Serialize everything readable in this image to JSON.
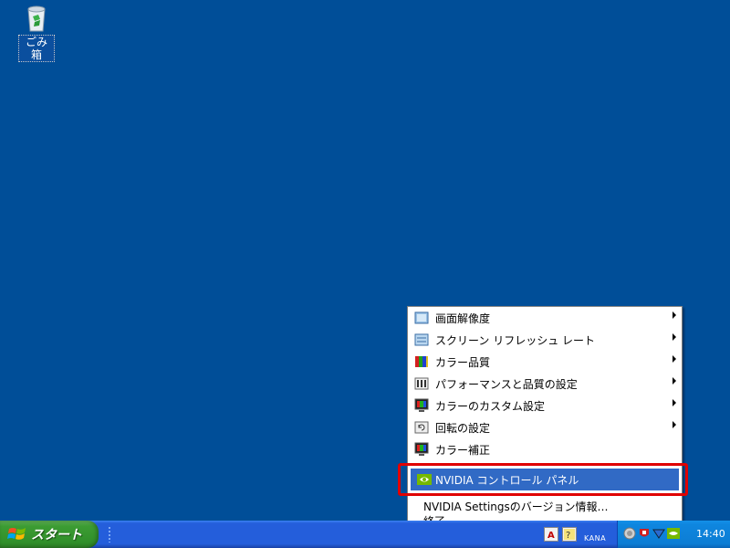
{
  "desktop": {
    "recycle_bin_label": "ごみ箱",
    "recycle_bin_icon": "recycle-bin-icon"
  },
  "context_menu": {
    "items": [
      {
        "label": "画面解像度",
        "icon": "display-resolution-icon",
        "submenu": true
      },
      {
        "label": "スクリーン リフレッシュ レート",
        "icon": "refresh-rate-icon",
        "submenu": true
      },
      {
        "label": "カラー品質",
        "icon": "color-quality-icon",
        "submenu": true
      },
      {
        "label": "パフォーマンスと品質の設定",
        "icon": "performance-quality-icon",
        "submenu": true
      },
      {
        "label": "カラーのカスタム設定",
        "icon": "custom-color-monitor-icon",
        "submenu": true
      },
      {
        "label": "回転の設定",
        "icon": "rotation-icon",
        "submenu": true
      },
      {
        "label": "カラー補正",
        "icon": "color-correction-monitor-icon",
        "submenu": false
      }
    ],
    "selected_item": {
      "label": "NVIDIA コントロール パネル",
      "icon": "nvidia-icon"
    },
    "bottom_items": [
      {
        "label": "NVIDIA Settingsのバージョン情報…"
      },
      {
        "label": "終了"
      }
    ],
    "highlight_color": "#e00000",
    "selection_color": "#316ac5"
  },
  "taskbar": {
    "start_label": "スタート",
    "language_bar": {
      "indicator": "KANA"
    },
    "tray": {
      "clock": "14:40"
    }
  }
}
